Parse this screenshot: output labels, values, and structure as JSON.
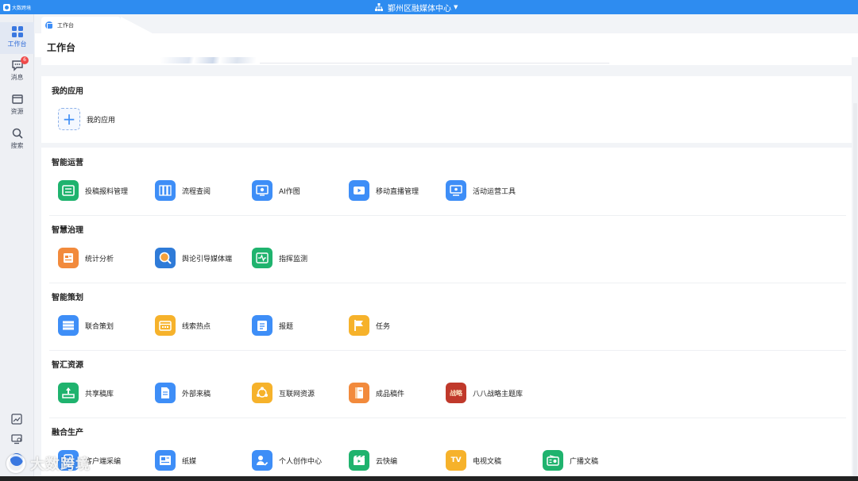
{
  "app": {
    "logo_text": "大数跨境",
    "org_name": "鄞州区融媒体中心"
  },
  "sidebar": {
    "items": [
      {
        "label": "工作台",
        "icon": "grid-icon"
      },
      {
        "label": "消息",
        "icon": "message-icon",
        "badge": "6"
      },
      {
        "label": "资源",
        "icon": "folder-icon"
      },
      {
        "label": "搜索",
        "icon": "search-icon"
      }
    ]
  },
  "tab": {
    "label": "工作台"
  },
  "page": {
    "title": "工作台"
  },
  "my_apps": {
    "title": "我的应用",
    "add_label": "我的应用"
  },
  "sections": [
    {
      "title": "智能运营",
      "apps": [
        {
          "label": "投稿报料管理",
          "color": "#1fb36e",
          "icon": "inbox-icon"
        },
        {
          "label": "流程查阅",
          "color": "#3e8ef7",
          "icon": "columns-icon"
        },
        {
          "label": "AI作图",
          "color": "#3e8ef7",
          "icon": "image-icon"
        },
        {
          "label": "移动直播管理",
          "color": "#3e8ef7",
          "icon": "video-icon"
        },
        {
          "label": "活动运营工具",
          "color": "#3e8ef7",
          "icon": "monitor-icon"
        }
      ]
    },
    {
      "title": "智慧治理",
      "apps": [
        {
          "label": "统计分析",
          "color": "#f28a3c",
          "icon": "report-icon"
        },
        {
          "label": "舆论引导媒体端",
          "color": "#2f7bd8",
          "icon": "magnifier-icon"
        },
        {
          "label": "指挥监测",
          "color": "#1fb36e",
          "icon": "pulse-icon"
        }
      ]
    },
    {
      "title": "智能策划",
      "apps": [
        {
          "label": "联合策划",
          "color": "#3e8ef7",
          "icon": "list-icon"
        },
        {
          "label": "线索热点",
          "color": "#f6b22b",
          "icon": "calendar-icon"
        },
        {
          "label": "报题",
          "color": "#3e8ef7",
          "icon": "clipboard-icon"
        },
        {
          "label": "任务",
          "color": "#f6b22b",
          "icon": "flag-icon"
        }
      ]
    },
    {
      "title": "智汇资源",
      "apps": [
        {
          "label": "共享稿库",
          "color": "#1fb36e",
          "icon": "share-icon"
        },
        {
          "label": "外部来稿",
          "color": "#3e8ef7",
          "icon": "document-icon"
        },
        {
          "label": "互联网资源",
          "color": "#f6b22b",
          "icon": "network-icon"
        },
        {
          "label": "成品稿件",
          "color": "#f28a3c",
          "icon": "book-icon"
        },
        {
          "label": "八八战略主题库",
          "color": "#c0392b",
          "icon": "strategy-icon",
          "icon_text": "战略"
        }
      ]
    },
    {
      "title": "融合生产",
      "apps": [
        {
          "label": "客户端采编",
          "color": "#3e8ef7",
          "icon": "phone-icon"
        },
        {
          "label": "纸媒",
          "color": "#3e8ef7",
          "icon": "newspaper-icon"
        },
        {
          "label": "个人创作中心",
          "color": "#3e8ef7",
          "icon": "person-edit-icon"
        },
        {
          "label": "云快编",
          "color": "#1fb36e",
          "icon": "film-icon"
        },
        {
          "label": "电视文稿",
          "color": "#f6b22b",
          "icon": "tv-icon",
          "icon_text": "TV"
        },
        {
          "label": "广播文稿",
          "color": "#1fb36e",
          "icon": "radio-icon"
        }
      ]
    }
  ],
  "watermark": {
    "text": "大数跨境"
  }
}
